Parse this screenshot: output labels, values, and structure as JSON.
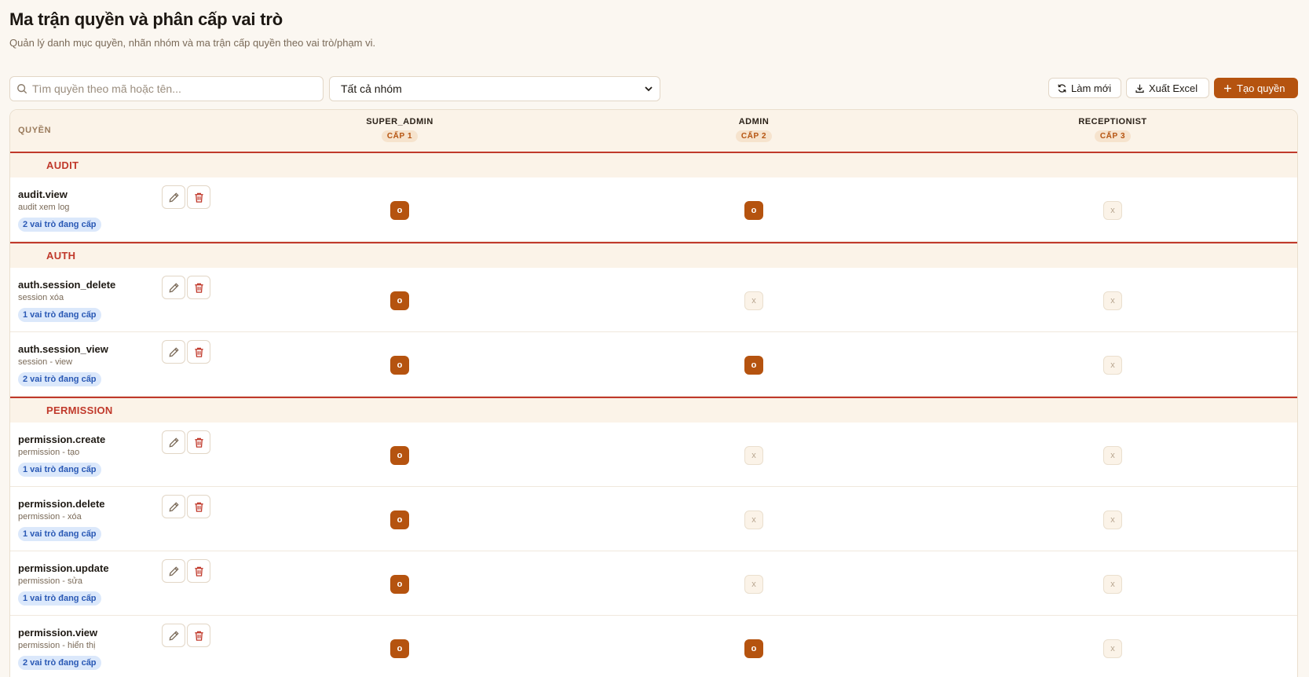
{
  "header": {
    "title": "Ma trận quyền và phân cấp vai trò",
    "subtitle": "Quản lý danh mục quyền, nhãn nhóm và ma trận cấp quyền theo vai trò/phạm vi."
  },
  "toolbar": {
    "search_placeholder": "Tìm quyền theo mã hoặc tên...",
    "search_value": "",
    "group_filter": "Tất cả nhóm",
    "refresh_label": "Làm mới",
    "export_label": "Xuất Excel",
    "create_label": "Tạo quyền"
  },
  "matrix": {
    "permission_header": "QUYỀN",
    "roles": [
      {
        "name": "SUPER_ADMIN",
        "level": "CẤP 1"
      },
      {
        "name": "ADMIN",
        "level": "CẤP 2"
      },
      {
        "name": "RECEPTIONIST",
        "level": "CẤP 3"
      }
    ],
    "groups": [
      {
        "name": "AUDIT",
        "permissions": [
          {
            "code": "audit.view",
            "desc": "audit xem log",
            "badge": "2 vai trò đang cấp",
            "grants": [
              "o",
              "o",
              "x"
            ]
          }
        ]
      },
      {
        "name": "AUTH",
        "permissions": [
          {
            "code": "auth.session_delete",
            "desc": "session xóa",
            "badge": "1 vai trò đang cấp",
            "grants": [
              "o",
              "x",
              "x"
            ]
          },
          {
            "code": "auth.session_view",
            "desc": "session - view",
            "badge": "2 vai trò đang cấp",
            "grants": [
              "o",
              "o",
              "x"
            ]
          }
        ]
      },
      {
        "name": "PERMISSION",
        "permissions": [
          {
            "code": "permission.create",
            "desc": "permission - tạo",
            "badge": "1 vai trò đang cấp",
            "grants": [
              "o",
              "x",
              "x"
            ]
          },
          {
            "code": "permission.delete",
            "desc": "permission - xóa",
            "badge": "1 vai trò đang cấp",
            "grants": [
              "o",
              "x",
              "x"
            ]
          },
          {
            "code": "permission.update",
            "desc": "permission - sửa",
            "badge": "1 vai trò đang cấp",
            "grants": [
              "o",
              "x",
              "x"
            ]
          },
          {
            "code": "permission.view",
            "desc": "permission - hiển thị",
            "badge": "2 vai trò đang cấp",
            "grants": [
              "o",
              "o",
              "x"
            ]
          }
        ]
      }
    ]
  },
  "icons": {
    "search": "search-icon",
    "chevron": "chevron-down-icon",
    "refresh": "refresh-icon",
    "export": "download-icon",
    "create": "plus-icon",
    "edit": "pencil-icon",
    "delete": "trash-icon"
  },
  "colors": {
    "accent": "#b5530f",
    "group_text": "#c0392b",
    "badge_bg": "#dbe8fb",
    "badge_text": "#2a59b5",
    "background": "#fbf7f1"
  }
}
